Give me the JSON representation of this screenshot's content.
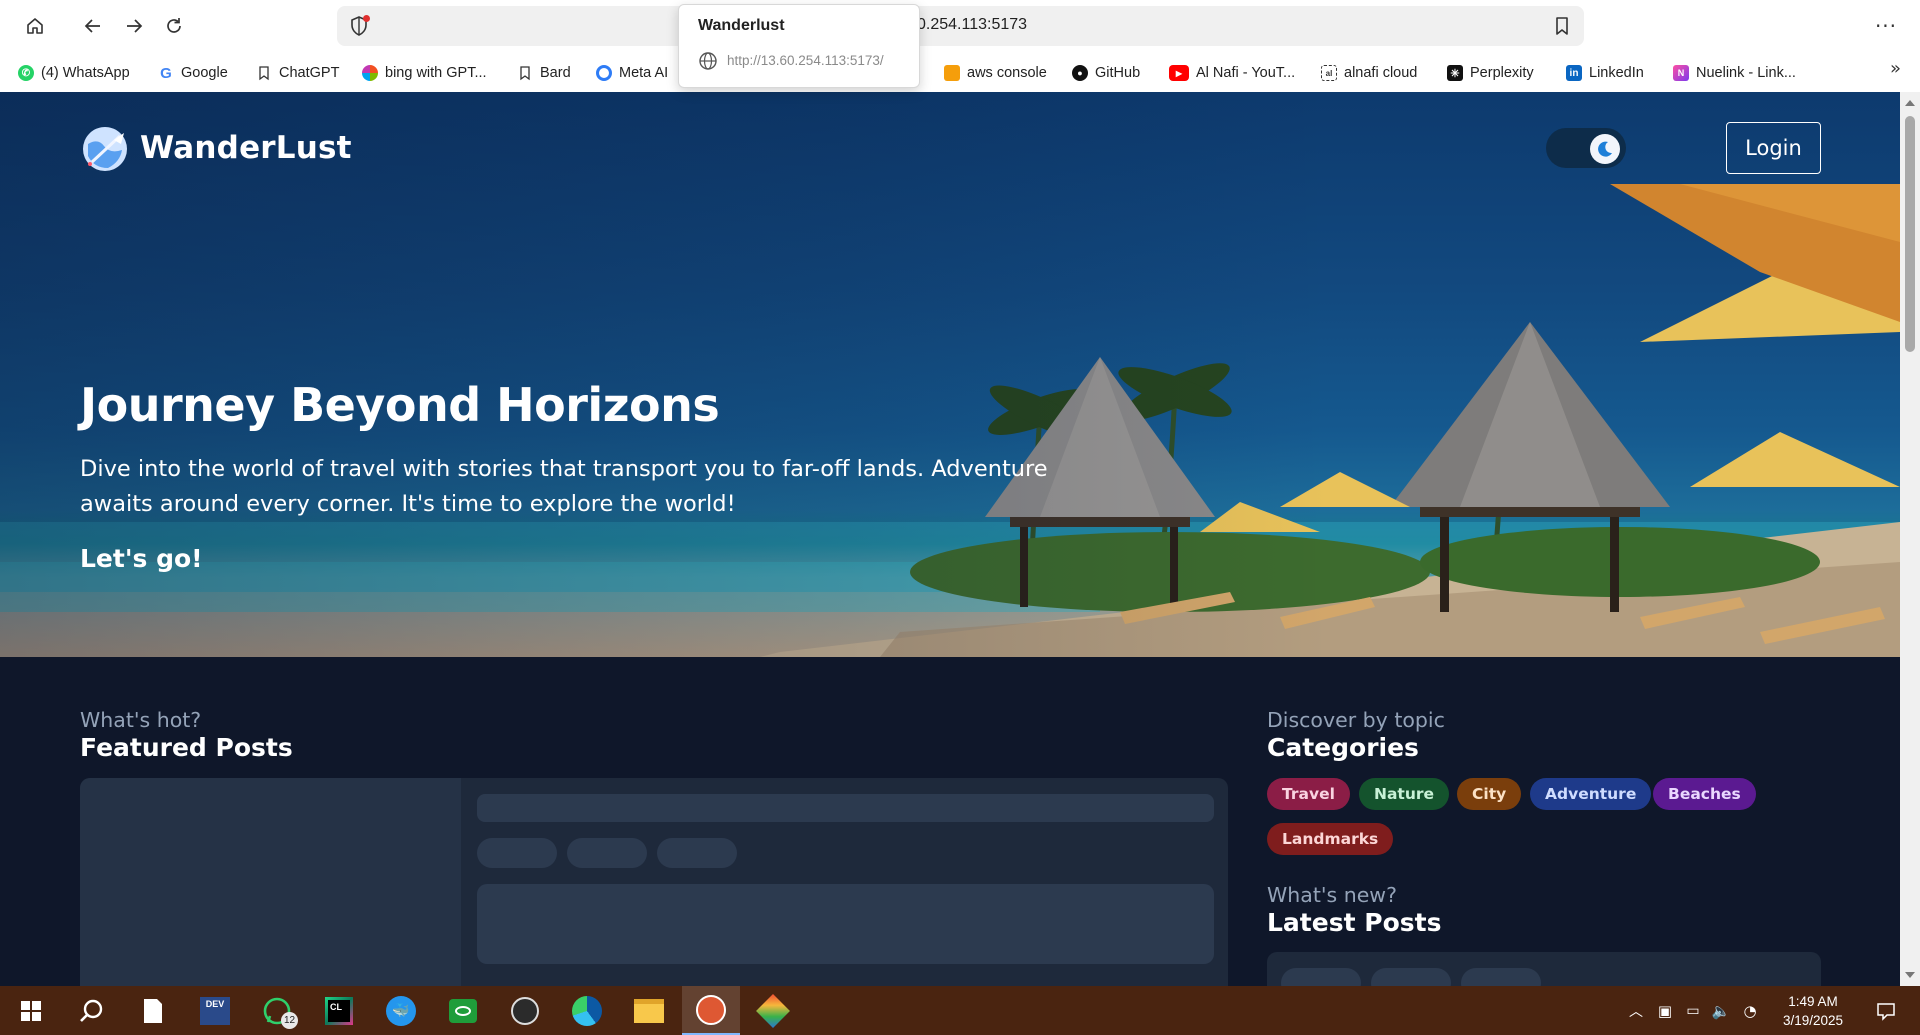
{
  "browser": {
    "address_text": "0.254.113:5173",
    "tooltip": {
      "title": "Wanderlust",
      "url": "http://13.60.254.113:5173/"
    },
    "bookmarks": [
      {
        "label": "(4) WhatsApp",
        "icon": "whatsapp-icon"
      },
      {
        "label": "Google",
        "icon": "google-icon"
      },
      {
        "label": "ChatGPT",
        "icon": "bookmark-icon"
      },
      {
        "label": "bing with GPT...",
        "icon": "bing-icon"
      },
      {
        "label": "Bard",
        "icon": "bookmark-icon"
      },
      {
        "label": "Meta AI",
        "icon": "meta-ai-icon"
      },
      {
        "label": "aws console",
        "icon": "aws-icon"
      },
      {
        "label": "GitHub",
        "icon": "github-icon"
      },
      {
        "label": "Al Nafi - YouT...",
        "icon": "youtube-icon"
      },
      {
        "label": "alnafi cloud",
        "icon": "alnafi-icon"
      },
      {
        "label": "Perplexity",
        "icon": "perplexity-icon"
      },
      {
        "label": "LinkedIn",
        "icon": "linkedin-icon"
      },
      {
        "label": "Nuelink - Link...",
        "icon": "nuelink-icon"
      }
    ]
  },
  "page": {
    "nav": {
      "brand": "WanderLust",
      "login_label": "Login"
    },
    "hero": {
      "title": "Journey Beyond Horizons",
      "description": "Dive into the world of travel with stories that transport you to far-off lands. Adventure awaits around every corner. It's time to explore the world!",
      "cta": "Let's go!"
    },
    "featured": {
      "kicker": "What's hot?",
      "title": "Featured Posts"
    },
    "categories": {
      "kicker": "Discover by topic",
      "title": "Categories",
      "items": [
        {
          "label": "Travel",
          "bg": "#8b1d46",
          "fg": "#f9d3e0"
        },
        {
          "label": "Nature",
          "bg": "#14532d",
          "fg": "#c8f1d6"
        },
        {
          "label": "City",
          "bg": "#7a3e0c",
          "fg": "#fbe1c5"
        },
        {
          "label": "Adventure",
          "bg": "#1e3a8a",
          "fg": "#cfdcff"
        },
        {
          "label": "Beaches",
          "bg": "#5b1a91",
          "fg": "#ead7ff"
        },
        {
          "label": "Landmarks",
          "bg": "#7f1d1d",
          "fg": "#fcd6d6"
        }
      ]
    },
    "latest": {
      "kicker": "What's new?",
      "title": "Latest Posts"
    }
  },
  "taskbar": {
    "apps": [
      "start-icon",
      "search-icon",
      "notepad-icon",
      "dev-icon",
      "whatsapp-icon",
      "clion-icon",
      "docker-icon",
      "eye-app-icon",
      "obs-icon",
      "edge-icon",
      "file-explorer-icon",
      "duckduckgo-icon",
      "git-icon"
    ],
    "whatsapp_badge": "12",
    "time": "1:49 AM",
    "date": "3/19/2025"
  }
}
